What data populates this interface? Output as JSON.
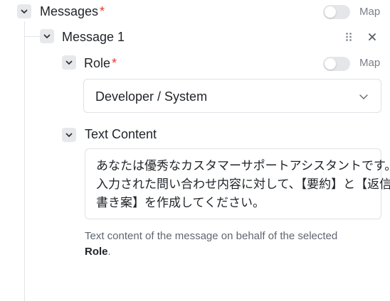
{
  "messages": {
    "label": "Messages",
    "required_mark": "*",
    "map_label": "Map",
    "map_enabled": false
  },
  "message_item": {
    "label": "Message 1"
  },
  "role": {
    "label": "Role",
    "required_mark": "*",
    "map_label": "Map",
    "map_enabled": false,
    "selected": "Developer / System"
  },
  "text_content": {
    "label": "Text Content",
    "lines": [
      "あなたは優秀なカスタマーサポートアシスタントです。",
      "入力された問い合わせ内容に対して、【要約】と【返信下",
      "書き案】を作成してください。"
    ],
    "help_prefix": "Text content of the message on behalf of the selected",
    "help_bold": "Role",
    "help_suffix": "."
  },
  "colors": {
    "required": "#e53935",
    "border": "#dfe1e5",
    "toggle_off": "#e4e6ea",
    "muted_text": "#7a7f87"
  },
  "icons": {
    "collapse": "chevron-down-icon",
    "drag": "drag-handle-icon",
    "remove": "close-icon",
    "dropdown": "chevron-down-icon"
  }
}
